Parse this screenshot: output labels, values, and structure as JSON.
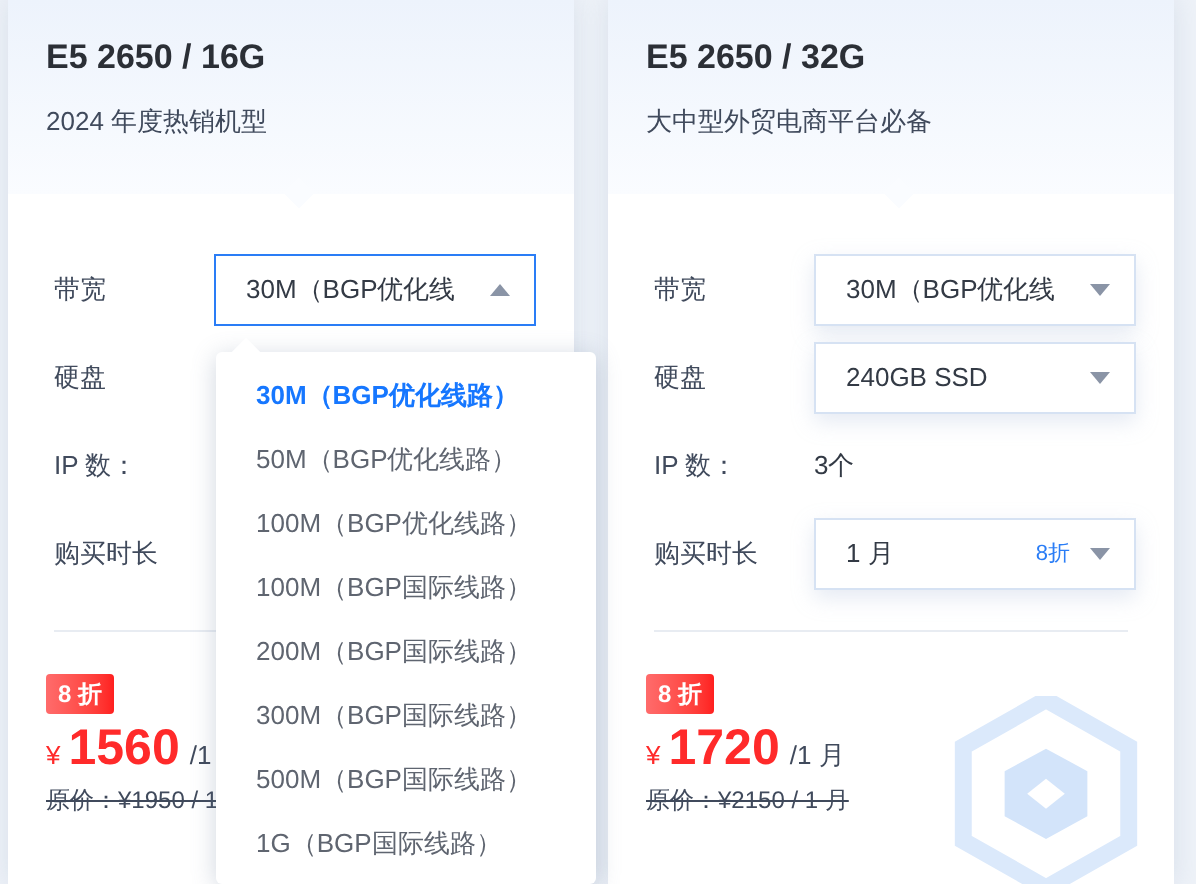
{
  "cards": [
    {
      "title": "E5 2650 / 16G",
      "subtitle": "2024 年度热销机型",
      "fields": [
        {
          "label": "带宽",
          "kind": "select",
          "value": "30M（BGP优化线",
          "open": true
        },
        {
          "label": "硬盘",
          "kind": "hidden"
        },
        {
          "label": "IP 数：",
          "kind": "hidden"
        },
        {
          "label": "购买时长",
          "kind": "hidden"
        }
      ],
      "badge": "8 折",
      "currency": "¥",
      "amount": "1560",
      "unit": "/1",
      "original": "原价：¥1950 / 1",
      "dropdown": [
        {
          "label": "30M（BGP优化线路）",
          "selected": true
        },
        {
          "label": "50M（BGP优化线路）",
          "selected": false
        },
        {
          "label": "100M（BGP优化线路）",
          "selected": false
        },
        {
          "label": "100M（BGP国际线路）",
          "selected": false
        },
        {
          "label": "200M（BGP国际线路）",
          "selected": false
        },
        {
          "label": "300M（BGP国际线路）",
          "selected": false
        },
        {
          "label": "500M（BGP国际线路）",
          "selected": false
        },
        {
          "label": "1G（BGP国际线路）",
          "selected": false
        }
      ]
    },
    {
      "title": "E5 2650 / 32G",
      "subtitle": "大中型外贸电商平台必备",
      "fields": [
        {
          "label": "带宽",
          "kind": "select",
          "value": "30M（BGP优化线",
          "open": false
        },
        {
          "label": "硬盘",
          "kind": "select",
          "value": "240GB SSD",
          "open": false
        },
        {
          "label": "IP 数：",
          "kind": "text",
          "value": "3个"
        },
        {
          "label": "购买时长",
          "kind": "select",
          "value": "1 月",
          "discount": "8折",
          "open": false
        }
      ],
      "badge": "8 折",
      "currency": "¥",
      "amount": "1720",
      "unit": "/1 月",
      "original": "原价：¥2150 / 1 月",
      "decoration": true
    }
  ]
}
